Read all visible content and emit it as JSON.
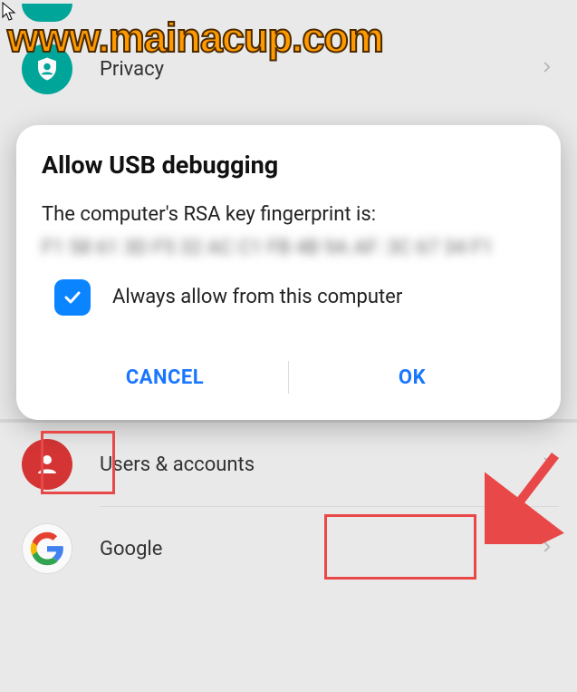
{
  "watermark": "www.mainacup.com",
  "settings": {
    "privacy": "Privacy",
    "users": "Users & accounts",
    "google": "Google"
  },
  "dialog": {
    "title": "Allow USB debugging",
    "message": "The computer's RSA key fingerprint is:",
    "fingerprint_blur": "F1 58 61 3D F5 32 AC C1 FB 4B 9A AF: 3C 67 34 F1",
    "checkbox_label": "Always allow from this computer",
    "cancel": "CANCEL",
    "ok": "OK"
  }
}
